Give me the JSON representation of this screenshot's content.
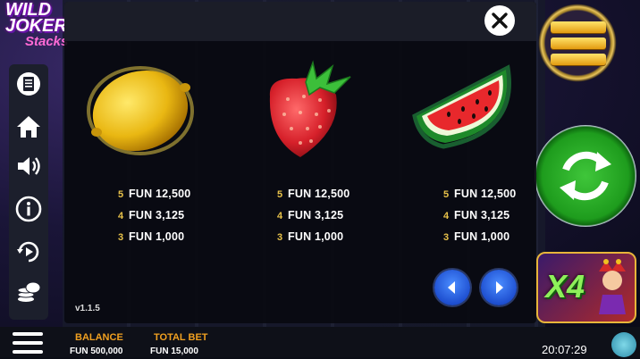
{
  "logo": {
    "line1": "WILD",
    "line2": "JOKER",
    "line3": "Stacks"
  },
  "paytable": {
    "symbols": [
      {
        "name": "lemon",
        "payouts": [
          {
            "count": "5",
            "amount": "FUN 12,500"
          },
          {
            "count": "4",
            "amount": "FUN 3,125"
          },
          {
            "count": "3",
            "amount": "FUN 1,000"
          }
        ]
      },
      {
        "name": "strawberry",
        "payouts": [
          {
            "count": "5",
            "amount": "FUN 12,500"
          },
          {
            "count": "4",
            "amount": "FUN 3,125"
          },
          {
            "count": "3",
            "amount": "FUN 1,000"
          }
        ]
      },
      {
        "name": "watermelon",
        "payouts": [
          {
            "count": "5",
            "amount": "FUN 12,500"
          },
          {
            "count": "4",
            "amount": "FUN 3,125"
          },
          {
            "count": "3",
            "amount": "FUN 1,000"
          }
        ]
      }
    ],
    "version": "v1.1.5"
  },
  "feature": {
    "multiplier": "X4"
  },
  "bottom": {
    "balance_label": "BALANCE",
    "balance_value": "FUN 500,000",
    "bet_label": "TOTAL BET",
    "bet_value": "FUN 15,000",
    "clock": "20:07:29"
  },
  "colors": {
    "accent": "#f0a020",
    "spin": "#2db52a",
    "nav": "#2a5be0"
  }
}
